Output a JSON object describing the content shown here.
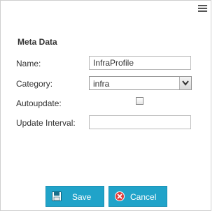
{
  "section_title": "Meta Data",
  "fields": {
    "name": {
      "label": "Name:",
      "value": "InfraProfile"
    },
    "category": {
      "label": "Category:",
      "value": "infra"
    },
    "autoupdate": {
      "label": "Autoupdate:",
      "checked": false
    },
    "update_interval": {
      "label": "Update Interval:",
      "value": ""
    }
  },
  "buttons": {
    "save": "Save",
    "cancel": "Cancel"
  },
  "icons": {
    "menu": "hamburger-menu-icon",
    "select_arrow": "chevron-down-icon",
    "save": "floppy-disk-icon",
    "cancel": "close-circle-icon"
  },
  "colors": {
    "button_bg": "#20a3c9",
    "cancel_icon": "#e03a3a"
  }
}
